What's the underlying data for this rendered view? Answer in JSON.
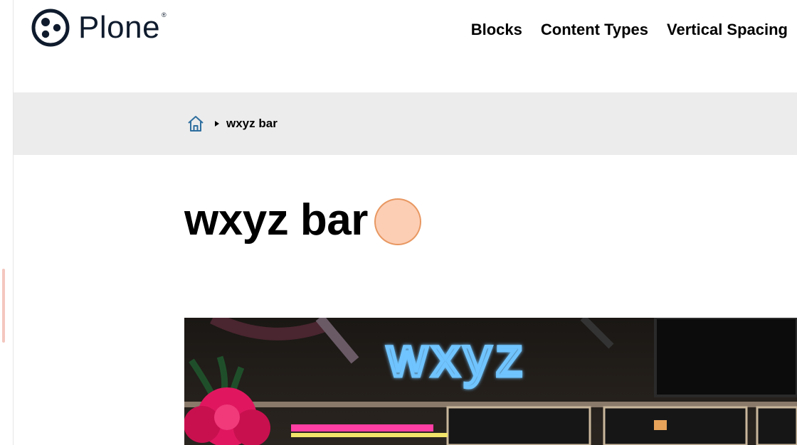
{
  "header": {
    "logo_text": "Plone",
    "logo_reg": "®",
    "nav": [
      "Blocks",
      "Content Types",
      "Vertical Spacing"
    ]
  },
  "breadcrumb": {
    "home_icon": "home-icon",
    "current": "wxyz bar"
  },
  "page": {
    "title": "wxyz bar"
  },
  "hero": {
    "sign_text": "wxyz",
    "sign_color": "#3aa8ff",
    "description": ""
  },
  "colors": {
    "breadcrumb_bg": "#ececec",
    "brand": "#0f1b2d",
    "click_indicator": "#fab48c"
  }
}
